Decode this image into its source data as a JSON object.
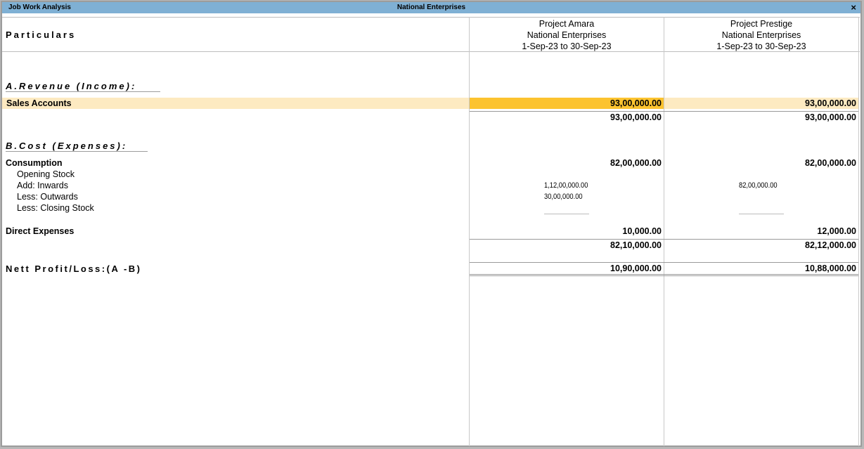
{
  "window": {
    "left_title": "Job Work Analysis",
    "center_title": "National Enterprises",
    "close_glyph": "×"
  },
  "header": {
    "particulars": "Particulars",
    "columns": [
      {
        "project": "Project Amara",
        "company": "National Enterprises",
        "period": "1-Sep-23 to 30-Sep-23"
      },
      {
        "project": "Project Prestige",
        "company": "National Enterprises",
        "period": "1-Sep-23 to 30-Sep-23"
      }
    ]
  },
  "revenue": {
    "heading": "A.Revenue (Income):",
    "sales_label": "Sales Accounts",
    "sales_values": [
      "93,00,000.00",
      "93,00,000.00"
    ],
    "total_values": [
      "93,00,000.00",
      "93,00,000.00"
    ]
  },
  "cost": {
    "heading": "B.Cost (Expenses):",
    "consumption_label": "Consumption",
    "consumption_values": [
      "82,00,000.00",
      "82,00,000.00"
    ],
    "opening_stock_label": "Opening Stock",
    "inwards_label": "Add: Inwards",
    "inwards_values": [
      "1,12,00,000.00",
      "82,00,000.00"
    ],
    "outwards_label": "Less: Outwards",
    "outwards_values": [
      "30,00,000.00"
    ],
    "closing_label": "Less: Closing Stock",
    "direct_label": "Direct Expenses",
    "direct_values": [
      "10,000.00",
      "12,000.00"
    ],
    "total_values": [
      "82,10,000.00",
      "82,12,000.00"
    ]
  },
  "net": {
    "label": "Nett Profit/Loss:(A -B)",
    "values": [
      "10,90,000.00",
      "10,88,000.00"
    ]
  },
  "colors": {
    "titlebar": "#7fb0d4",
    "row_highlight": "#fdeac1",
    "cell_highlight": "#fcc32f"
  }
}
